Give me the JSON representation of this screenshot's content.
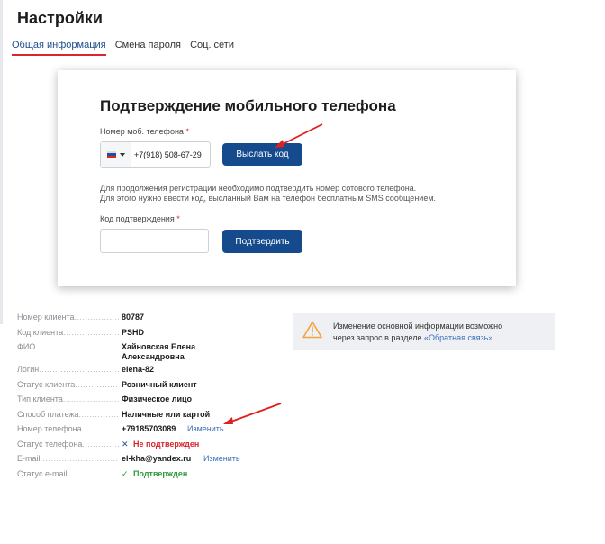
{
  "page": {
    "title": "Настройки",
    "tabs": [
      {
        "label": "Общая информация",
        "active": true
      },
      {
        "label": "Смена пароля",
        "active": false
      },
      {
        "label": "Соц. сети",
        "active": false
      }
    ]
  },
  "modal": {
    "title": "Подтверждение мобильного телефона",
    "phone_label": "Номер моб. телефона",
    "required_mark": "*",
    "country_flag": "russia-flag-icon",
    "phone_value": "+7(918) 508-67-29",
    "send_code_button": "Выслать код",
    "info_line1": "Для продолжения регистрации необходимо подтвердить номер сотового телефона.",
    "info_line2": "Для этого нужно ввести код, высланный Вам на телефон бесплатным SMS сообщением.",
    "code_label": "Код подтверждения",
    "code_value": "",
    "confirm_button": "Подтвердить"
  },
  "details": {
    "client_number": {
      "label": "Номер клиента",
      "value": "80787"
    },
    "client_code": {
      "label": "Код клиента",
      "value": "PSHD"
    },
    "full_name": {
      "label": "ФИО",
      "value_line1": "Хайновская Елена",
      "value_line2": "Александровна"
    },
    "login": {
      "label": "Логин",
      "value": "elena-82"
    },
    "client_status": {
      "label": "Статус клиента",
      "value": "Розничный клиент"
    },
    "client_type": {
      "label": "Тип клиента",
      "value": "Физическое лицо"
    },
    "payment_method": {
      "label": "Способ платежа",
      "value": "Наличные или картой"
    },
    "phone_number": {
      "label": "Номер телефона",
      "value": "+79185703089",
      "action": "Изменить"
    },
    "phone_status": {
      "label": "Статус телефона",
      "value": "Не подтвержден",
      "icon": "cross-icon"
    },
    "email": {
      "label": "E-mail",
      "value": "el-kha@yandex.ru",
      "action": "Изменить"
    },
    "email_status": {
      "label": "Статус e-mail",
      "value": "Подтвержден",
      "icon": "checkmark-icon"
    }
  },
  "notice": {
    "icon": "warning-icon",
    "line1": "Изменение основной информации возможно",
    "line2_prefix": "через запрос в разделе ",
    "link": "«Обратная связь»"
  },
  "colors": {
    "primary_button": "#154b8c",
    "accent_red": "#d7262e",
    "link_blue": "#3a6fb8",
    "success_green": "#2e9a3c",
    "warning_orange": "#f3a43a",
    "annotation_arrow": "#e02020"
  }
}
